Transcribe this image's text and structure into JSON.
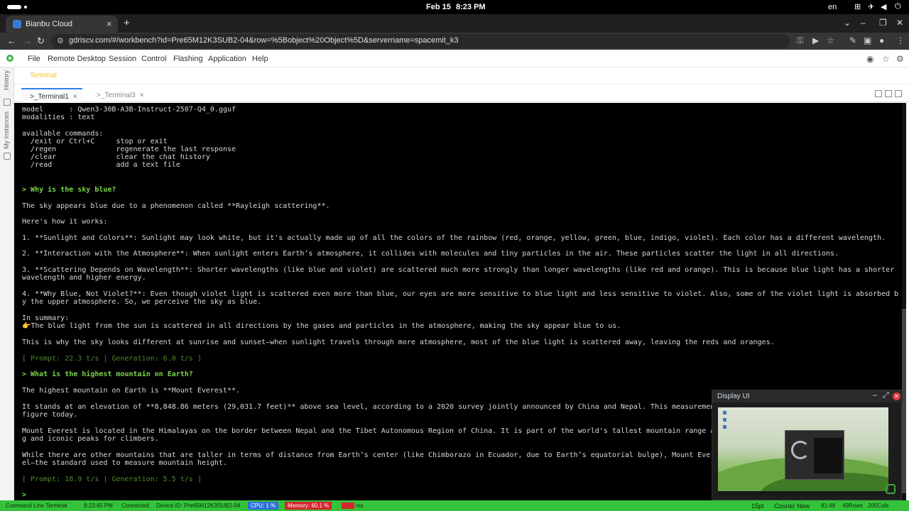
{
  "os": {
    "date": "Feb 15",
    "time": "8:23 PM",
    "lang": "en"
  },
  "browser": {
    "tab_title": "Bianbu Cloud",
    "url": "gdriscv.com/#/workbench?id=Pre65M12K3SUB2-04&row=%5Bobject%20Object%5D&servername=spacemit_k3"
  },
  "menu": {
    "items": [
      "File",
      "Remote Desktop",
      "Session",
      "Control",
      "Flashing",
      "Application",
      "Help"
    ]
  },
  "rail": {
    "history": "History",
    "instances": "My Instances"
  },
  "terminal_header": "Terminal",
  "terminal_tabs": [
    ">_Terminal1",
    ">_Terminal3"
  ],
  "terminal_lines": [
    {
      "text": "model      : Qwen3-30B-A3B-Instruct-2507-Q4_0.gguf",
      "style": ""
    },
    {
      "text": "modalities : text",
      "style": ""
    },
    {
      "text": "",
      "style": ""
    },
    {
      "text": "available commands:",
      "style": ""
    },
    {
      "text": "  /exit or Ctrl+C     stop or exit",
      "style": ""
    },
    {
      "text": "  /regen              regenerate the last response",
      "style": ""
    },
    {
      "text": "  /clear              clear the chat history",
      "style": ""
    },
    {
      "text": "  /read               add a text file",
      "style": ""
    },
    {
      "text": "> Why is the sky blue?",
      "style": "g"
    },
    {
      "text": "The sky appears blue due to a phenomenon called **Rayleigh scattering**.",
      "style": ""
    },
    {
      "text": "Here's how it works:",
      "style": ""
    },
    {
      "text": "1. **Sunlight and Colors**: Sunlight may look white, but it's actually made up of all the colors of the rainbow (red, orange, yellow, green, blue, indigo, violet). Each color has a different wavelength.",
      "style": ""
    },
    {
      "text": "2. **Interaction with the Atmosphere**: When sunlight enters Earth’s atmosphere, it collides with molecules and tiny particles in the air. These particles scatter the light in all directions.",
      "style": ""
    },
    {
      "text": "3. **Scattering Depends on Wavelength**: Shorter wavelengths (like blue and violet) are scattered much more strongly than longer wavelengths (like red and orange). This is because blue light has a shorter",
      "style": ""
    },
    {
      "text": "wavelength and higher energy.",
      "style": ""
    },
    {
      "text": "4. **Why Blue, Not Violet?**: Even though violet light is scattered even more than blue, our eyes are more sensitive to blue light and less sensitive to violet. Also, some of the violet light is absorbed b",
      "style": ""
    },
    {
      "text": "y the upper atmosphere. So, we perceive the sky as blue.",
      "style": ""
    },
    {
      "text": "In summary:",
      "style": ""
    },
    {
      "text": "👉The blue light from the sun is scattered in all directions by the gases and particles in the atmosphere, making the sky appear blue to us.",
      "style": ""
    },
    {
      "text": "This is why the sky looks different at sunrise and sunset—when sunlight travels through more atmosphere, most of the blue light is scattered away, leaving the reds and oranges.",
      "style": ""
    },
    {
      "text": "[ Prompt: 22.3 t/s | Generation: 6.0 t/s ]",
      "style": "dim"
    },
    {
      "text": "> What is the highest mountain on Earth?",
      "style": "g"
    },
    {
      "text": "The highest mountain on Earth is **Mount Everest**.",
      "style": ""
    },
    {
      "text": "It stands at an elevation of **8,848.86 meters (29,031.7 feet)** above sea level, according to a 2020 survey jointly announced by China and Nepal. This measuremen",
      "style": ""
    },
    {
      "text": "figure today.",
      "style": ""
    },
    {
      "text": "Mount Everest is located in the Himalayas on the border between Nepal and the Tibet Autonomous Region of China. It is part of the world's tallest mountain range a",
      "style": ""
    },
    {
      "text": "g and iconic peaks for climbers.",
      "style": ""
    },
    {
      "text": "While there are other mountains that are taller in terms of distance from Earth’s center (like Chimborazo in Ecuador, due to Earth’s equatorial bulge), Mount Ever",
      "style": ""
    },
    {
      "text": "el—the standard used to measure mountain height.",
      "style": ""
    },
    {
      "text": "[ Prompt: 18.9 t/s | Generation: 5.5 t/s ]",
      "style": "dim"
    },
    {
      "text": "> ",
      "style": "g"
    }
  ],
  "display_ui": {
    "title": "Display UI"
  },
  "status": {
    "terminal": "Command Line Terminal",
    "time": "8:23:45 PM",
    "connection": "Connected",
    "device": "Device ID: Pre65M12K3SUB2-04",
    "cpu": "CPU: 1 %",
    "memory": "Memory: 60.1 %",
    "latency": "ms",
    "font_size": "15pt",
    "font_name": "Courier New",
    "position": "81:48",
    "rows": "49Rows",
    "cols": "205Cols"
  }
}
